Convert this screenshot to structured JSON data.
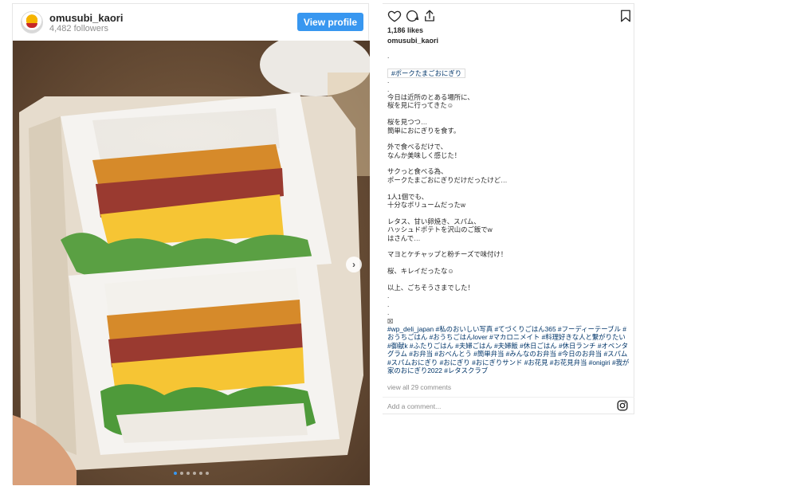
{
  "profile": {
    "username": "omusubi_kaori",
    "followers": "4,482 followers",
    "view_profile_label": "View profile"
  },
  "carousel": {
    "dot_count": 6,
    "active_index": 0
  },
  "post": {
    "likes": "1,186 likes",
    "caption_user": "omusubi_kaori",
    "caption_lines": [
      ".",
      "",
      "#ポークたまごおにぎり",
      ".",
      ".",
      "今日は近所のとある場所に、",
      "桜を見に行ってきた☺",
      "",
      "桜を見つつ…",
      "簡単におにぎりを食す。",
      "",
      "外で食べるだけで、",
      "なんか美味しく感じた！",
      "",
      "サクっと食べる為、",
      "ポークたまごおにぎりだけだったけど…",
      "",
      "1人1個でも、",
      "十分なボリュームだったw",
      "",
      "レタス、甘い卵焼き、スパム、",
      "ハッシュドポテトを沢山のご飯でw",
      "はさんで…",
      "",
      "マヨとケチャップと粉チーズで味付け！",
      "",
      "桜、キレイだったな☺",
      "",
      "以上、ごちそうさまでした！",
      ".",
      ".",
      "."
    ],
    "tag_marker": "☒",
    "tags": "#wp_deli_japan #私のおいしい写真 #てづくりごはん365 #フーディーテーブル #おうちごはん #おうちごはんlover #マカロニメイト #料理好きな人と繋がりたい #御献k #ふたりごはん #夫婦ごはん #夫婦飯 #休日ごはん #休日ランチ #オベンタグラム #お弁当 #おべんとう #簡単弁当 #みんなのお弁当 #今日のお弁当 #スパム #スパムおにぎり #おにぎり #おにぎりサンド #お花見 #お花見弁当 #onigiri #我が家のおにぎり2022 #レタスクラブ",
    "view_comments": "view all 29 comments",
    "add_comment_placeholder": "Add a comment..."
  },
  "icons": {
    "like": "heart-icon",
    "comment": "comment-icon",
    "share": "share-icon",
    "save": "bookmark-icon",
    "instagram": "instagram-icon",
    "carousel_next": "chevron-right-icon"
  },
  "colors": {
    "button_blue": "#3897f0",
    "hashtag": "#003569",
    "muted": "#8e8e8e"
  }
}
